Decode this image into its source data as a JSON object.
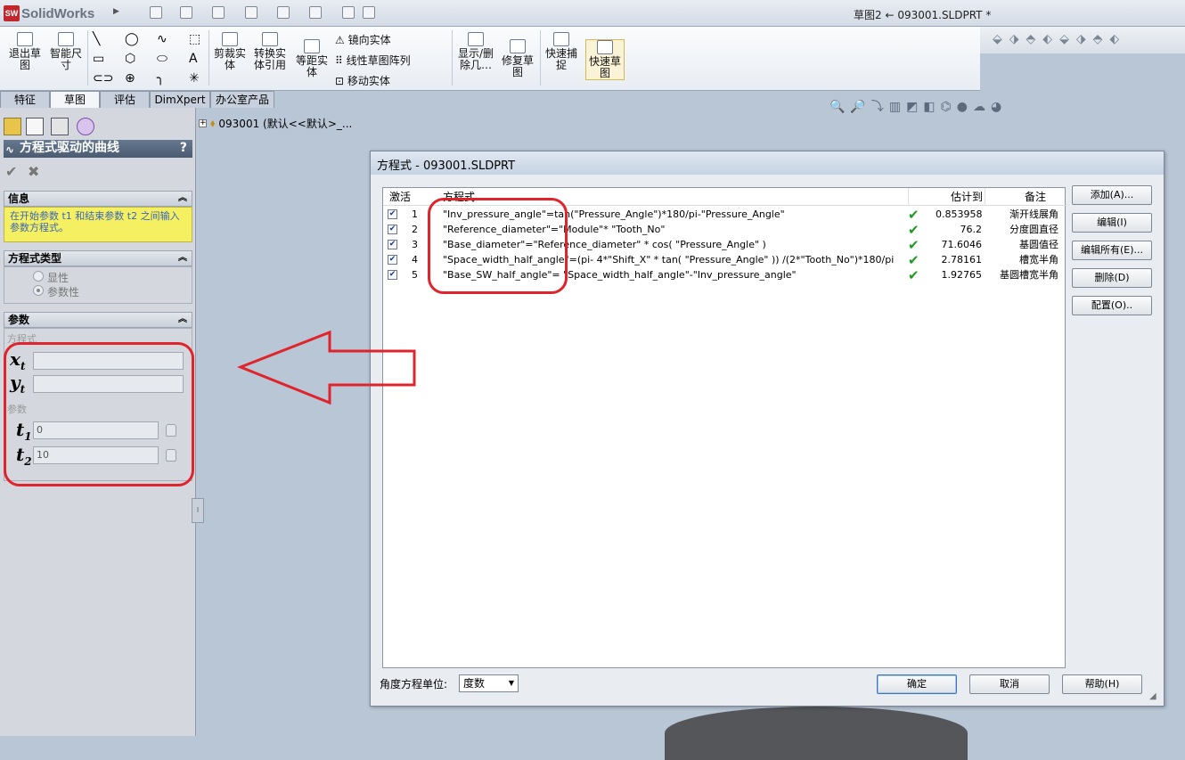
{
  "app": {
    "logo": "SolidWorks",
    "doc_title": "草图2 ← 093001.SLDPRT *"
  },
  "ribbon": {
    "exit_sketch": "退出草图",
    "smart_dim": "智能尺寸",
    "trim": "剪裁实体",
    "convert": "转换实体引用",
    "offset": "等距实体",
    "mirror": "镜向实体",
    "linear_pattern": "线性草图阵列",
    "move": "移动实体",
    "show_delete": "显示/删除几…",
    "repair": "修复草图",
    "snap": "快速捕捉",
    "quick_sketch": "快速草图"
  },
  "tabs": [
    "特征",
    "草图",
    "评估",
    "DimXpert",
    "办公室产品"
  ],
  "tree": {
    "item": "093001 (默认<<默认>_..."
  },
  "left": {
    "title": "方程式驱动的曲线",
    "help": "?",
    "info_header": "信息",
    "info_text": "在开始参数 t1 和结束参数 t2 之间输入参数方程式。",
    "type_header": "方程式类型",
    "type_explicit": "显性",
    "type_parametric": "参数性",
    "param_header": "参数",
    "equation_label": "方程式",
    "params_label": "参数",
    "xt": "x",
    "yt": "y",
    "t1": "t",
    "t2": "t",
    "sub_t": "t",
    "sub_1": "1",
    "sub_2": "2",
    "t1_value": "0",
    "t2_value": "10"
  },
  "dialog": {
    "title": "方程式 - 093001.SLDPRT",
    "columns": {
      "active": "激活",
      "equation": "方程式",
      "evaluates": "估计到",
      "notes": "备注"
    },
    "rows": [
      {
        "n": "1",
        "eq": "\"Inv_pressure_angle\"=tan(\"Pressure_Angle\")*180/pi-\"Pressure_Angle\"",
        "val": "0.853958",
        "note": "渐开线展角"
      },
      {
        "n": "2",
        "eq": "\"Reference_diameter\"=\"Module\"* \"Tooth_No\"",
        "val": "76.2",
        "note": "分度圆直径"
      },
      {
        "n": "3",
        "eq": "\"Base_diameter\"=\"Reference_diameter\" *  cos( \"Pressure_Angle\" )",
        "val": "71.6046",
        "note": "基圆值径"
      },
      {
        "n": "4",
        "eq": "\"Space_width_half_angle\"=(pi- 4*\"Shift_X\" *  tan( \"Pressure_Angle\" )) /(2*\"Tooth_No\")*180/pi",
        "val": "2.78161",
        "note": "槽宽半角"
      },
      {
        "n": "5",
        "eq": "\"Base_SW_half_angle\"= \"Space_width_half_angle\"-\"Inv_pressure_angle\"",
        "val": "1.92765",
        "note": "基圆槽宽半角"
      }
    ],
    "buttons": {
      "add": "添加(A)...",
      "edit": "编辑(I)",
      "edit_all": "编辑所有(E)...",
      "delete": "删除(D)",
      "config": "配置(O).."
    },
    "angle_label": "角度方程单位:",
    "angle_value": "度数",
    "ok": "确定",
    "cancel": "取消",
    "help": "帮助(H)"
  }
}
